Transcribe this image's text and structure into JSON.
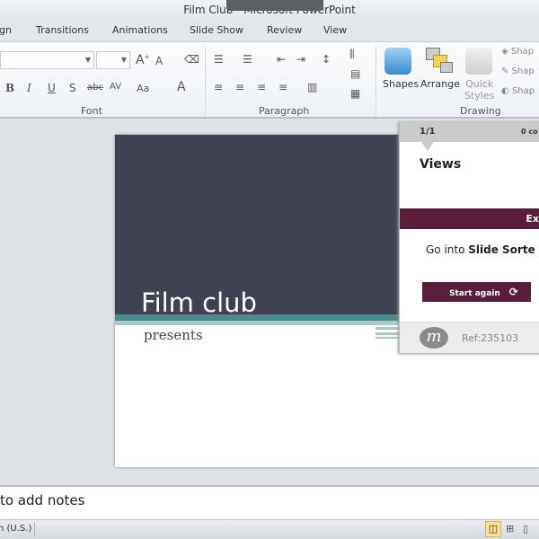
{
  "window": {
    "title": "Film Club - Microsoft PowerPoint"
  },
  "tabs": [
    "gn",
    "Transitions",
    "Animations",
    "Slide Show",
    "Review",
    "View"
  ],
  "ribbon": {
    "groups": [
      "Font",
      "Paragraph",
      "Drawing"
    ],
    "drawing": {
      "shapes": "Shapes",
      "arrange": "Arrange",
      "quick_styles_1": "Quick",
      "quick_styles_2": "Styles",
      "shape_fill": "Shap",
      "shape_outline": "Shap",
      "shape_effects": "Shap"
    }
  },
  "slide": {
    "title": "Film club",
    "subtitle": "presents"
  },
  "panel": {
    "progress": "1/1",
    "comments": "0 co",
    "heading": "Views",
    "bar": "Ex",
    "instruction_prefix": "Go into ",
    "instruction_bold": "Slide Sorte",
    "button": "Start again",
    "ref": "Ref:235103",
    "colors": {
      "accent": "#5b1d3c"
    }
  },
  "notes": {
    "placeholder": "to add notes"
  },
  "status": {
    "language": "n (U.S.)"
  }
}
